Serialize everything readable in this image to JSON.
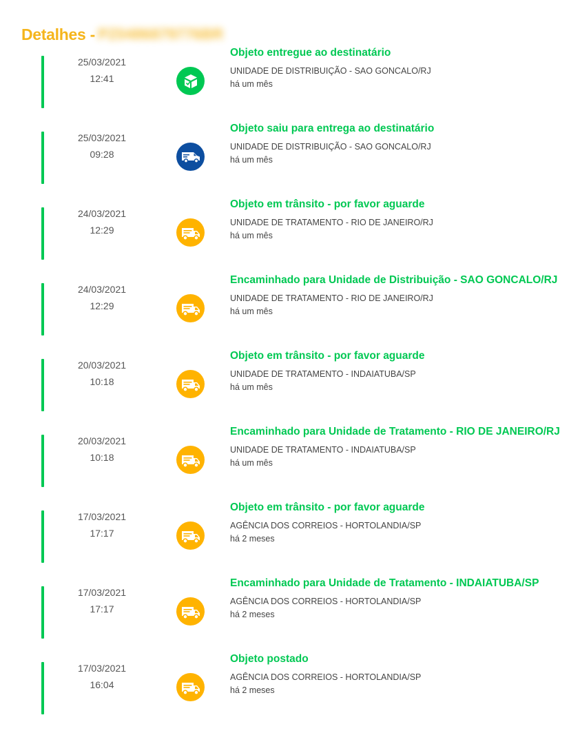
{
  "header": {
    "title": "Detalhes -",
    "tracking_code": "PZ0486879776BR"
  },
  "colors": {
    "accent_yellow": "#f5b51c",
    "status_green": "#00c853",
    "truck_yellow": "#ffb300",
    "van_blue": "#0d4ea0",
    "delivered_green": "#00c853"
  },
  "events": [
    {
      "date": "25/03/2021",
      "time": "12:41",
      "title": "Objeto entregue ao destinatário",
      "location": "UNIDADE DE DISTRIBUIÇÃO - SAO GONCALO/RJ",
      "ago": "há um mês",
      "icon": "package-delivered-icon",
      "icon_color": "#00c853"
    },
    {
      "date": "25/03/2021",
      "time": "09:28",
      "title": "Objeto saiu para entrega ao destinatário",
      "location": "UNIDADE DE DISTRIBUIÇÃO - SAO GONCALO/RJ",
      "ago": "há um mês",
      "icon": "delivery-van-icon",
      "icon_color": "#0d4ea0"
    },
    {
      "date": "24/03/2021",
      "time": "12:29",
      "title": "Objeto em trânsito - por favor aguarde",
      "location": "UNIDADE DE TRATAMENTO - RIO DE JANEIRO/RJ",
      "ago": "há um mês",
      "icon": "truck-icon",
      "icon_color": "#ffb300"
    },
    {
      "date": "24/03/2021",
      "time": "12:29",
      "title": "Encaminhado para Unidade de Distribuição - SAO GONCALO/RJ",
      "location": "UNIDADE DE TRATAMENTO - RIO DE JANEIRO/RJ",
      "ago": "há um mês",
      "icon": "truck-icon",
      "icon_color": "#ffb300"
    },
    {
      "date": "20/03/2021",
      "time": "10:18",
      "title": "Objeto em trânsito - por favor aguarde",
      "location": "UNIDADE DE TRATAMENTO - INDAIATUBA/SP",
      "ago": "há um mês",
      "icon": "truck-icon",
      "icon_color": "#ffb300"
    },
    {
      "date": "20/03/2021",
      "time": "10:18",
      "title": "Encaminhado para Unidade de Tratamento - RIO DE JANEIRO/RJ",
      "location": "UNIDADE DE TRATAMENTO - INDAIATUBA/SP",
      "ago": "há um mês",
      "icon": "truck-icon",
      "icon_color": "#ffb300"
    },
    {
      "date": "17/03/2021",
      "time": "17:17",
      "title": "Objeto em trânsito - por favor aguarde",
      "location": "AGÊNCIA DOS CORREIOS - HORTOLANDIA/SP",
      "ago": "há 2 meses",
      "icon": "truck-icon",
      "icon_color": "#ffb300"
    },
    {
      "date": "17/03/2021",
      "time": "17:17",
      "title": "Encaminhado para Unidade de Tratamento - INDAIATUBA/SP",
      "location": "AGÊNCIA DOS CORREIOS - HORTOLANDIA/SP",
      "ago": "há 2 meses",
      "icon": "truck-icon",
      "icon_color": "#ffb300"
    },
    {
      "date": "17/03/2021",
      "time": "16:04",
      "title": "Objeto postado",
      "location": "AGÊNCIA DOS CORREIOS - HORTOLANDIA/SP",
      "ago": "há 2 meses",
      "icon": "truck-icon",
      "icon_color": "#ffb300"
    }
  ]
}
